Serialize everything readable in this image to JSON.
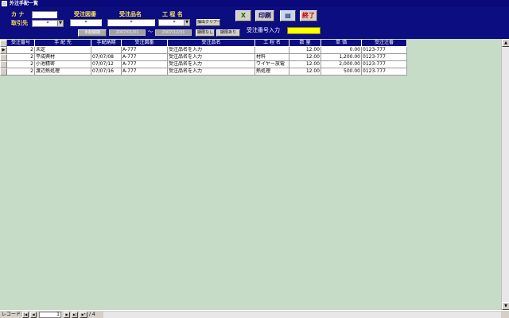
{
  "window": {
    "title": "外注手配一覧"
  },
  "header": {
    "kana_label": "カ ナ",
    "torihiki_label": "取引先",
    "torihiki_value": "*",
    "zuban_label": "受注図番",
    "zuban_value": "*",
    "hinmei_label": "受注品名",
    "hinmei_value": "*",
    "kotei_label": "工 程 名",
    "kotei_value": "*",
    "clear_button": "抽出クリアー",
    "noki_label": "手配納期",
    "date_from": "2007/01/01",
    "date_sep": "～",
    "date_to": "2007/12/31",
    "filter_none_button": "期限なし",
    "filter_sel_button": "期限あり",
    "order_input_label": "受注番号入力",
    "excel_button": "X",
    "print_button": "印刷",
    "grid_button": "▤",
    "end_button": "終了"
  },
  "table": {
    "columns": [
      "受注番号",
      "手 配 先",
      "手配納期",
      "受注図番",
      "受注品名",
      "工 程 名",
      "数 量",
      "単 価",
      "受注注番"
    ],
    "rows": [
      [
        "2",
        "未定",
        "",
        "A-777",
        "受注品名を入力",
        "",
        "12.00",
        "0.00",
        "0123-777"
      ],
      [
        "2",
        "平成興材",
        "07/07/08",
        "A-777",
        "受注品名を入力",
        "材料",
        "12.00",
        "1,200.00",
        "0123-777"
      ],
      [
        "2",
        "小池精密",
        "07/07/12",
        "A-777",
        "受注品名を入力",
        "ワイヤー放電",
        "12.00",
        "2,000.00",
        "0123-777"
      ],
      [
        "2",
        "渡辺熱処理",
        "07/07/16",
        "A-777",
        "受注品名を入力",
        "熱処理",
        "12.00",
        "500.00",
        "0123-777"
      ]
    ]
  },
  "navbar": {
    "label": "レコード:",
    "current": "1",
    "total": "/ 4"
  },
  "icons": {
    "first": "|◀",
    "prev": "◀",
    "next": "▶",
    "last": "▶|",
    "new": "▶*",
    "row_selector": "▶"
  }
}
